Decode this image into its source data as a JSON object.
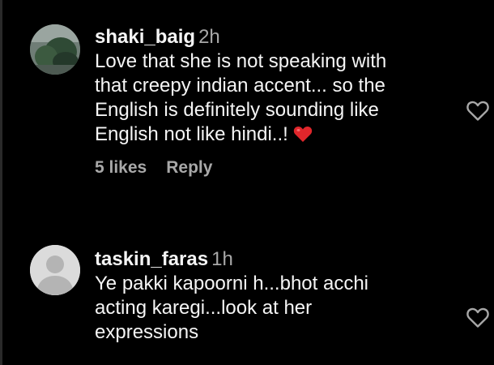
{
  "comments": [
    {
      "username": "shaki_baig",
      "time": "2h",
      "text": "Love that she is not speaking with\nthat creepy indian accent... so the\nEnglish is definitely sounding like\nEnglish not like hindi..!",
      "emoji": "red-heart-emoji",
      "likes": "5 likes",
      "reply": "Reply",
      "avatar": "profile-photo"
    },
    {
      "username": "taskin_faras",
      "time": "1h",
      "text": "Ye pakki kapoorni h...bhot acchi\nacting karegi...look at her\nexpressions",
      "avatar": "default-avatar"
    }
  ],
  "icons": {
    "like": "heart-outline-icon"
  },
  "colors": {
    "background": "#000000",
    "primary_text": "#f5f5f5",
    "secondary_text": "#a8a8a8",
    "heart_emoji": "#e0262b"
  }
}
